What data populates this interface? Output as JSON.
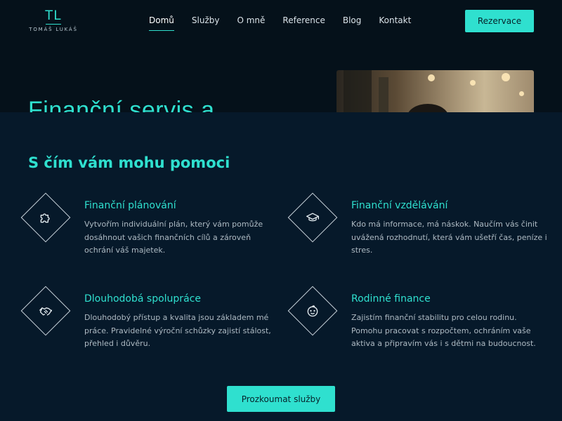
{
  "logo": {
    "initials": "TL",
    "name": "TOMÁŠ LUKÁŠ"
  },
  "nav": {
    "items": [
      {
        "label": "Domů",
        "active": true
      },
      {
        "label": "Služby"
      },
      {
        "label": "O mně"
      },
      {
        "label": "Reference"
      },
      {
        "label": "Blog"
      },
      {
        "label": "Kontakt"
      }
    ]
  },
  "header": {
    "reserve_label": "Rezervace"
  },
  "hero": {
    "title": "Finanční servis a"
  },
  "services": {
    "title": "S čím vám mohu pomoci",
    "items": [
      {
        "icon": "puzzle-icon",
        "title": "Finanční plánování",
        "text": "Vytvořím individuální plán, který vám pomůže dosáhnout vašich finančních cílů a zároveň ochrání váš majetek."
      },
      {
        "icon": "graduation-cap-icon",
        "title": "Finanční vzdělávání",
        "text": "Kdo má informace, má náskok. Naučím vás činit uvážená rozhodnutí, která vám ušetří čas, peníze i stres."
      },
      {
        "icon": "handshake-icon",
        "title": "Dlouhodobá spolupráce",
        "text": "Dlouhodobý přístup a kvalita jsou základem mé práce. Pravidelné výroční schůzky zajistí stálost, přehled i důvěru."
      },
      {
        "icon": "baby-face-icon",
        "title": "Rodinné finance",
        "text": "Zajistím finanční stabilitu pro celou rodinu. Pomohu pracovat s rozpočtem, ochráním vaše aktiva a připravím vás i s dětmi na budoucnost."
      }
    ],
    "cta_label": "Prozkoumat služby"
  },
  "colors": {
    "accent": "#2fe0cf",
    "background": "#05111a",
    "panel": "#06192a"
  }
}
